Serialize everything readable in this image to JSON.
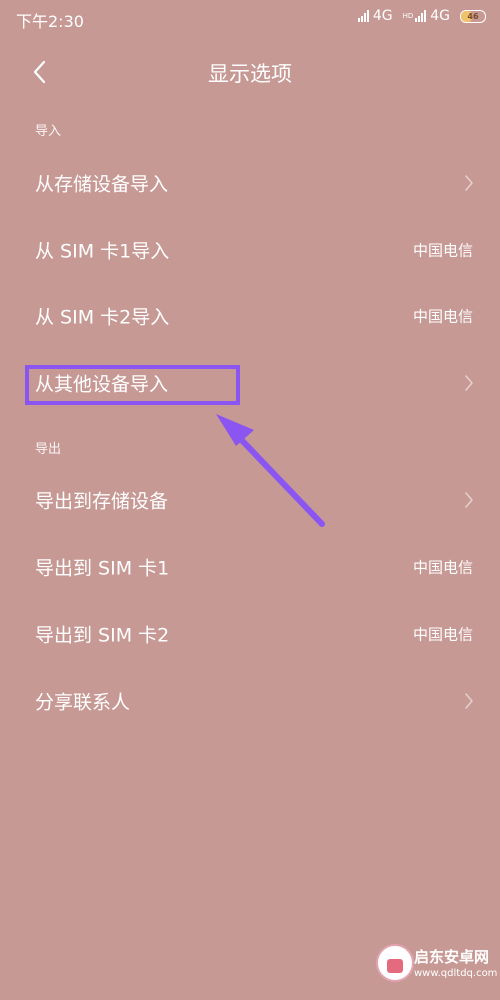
{
  "status_bar": {
    "time": "下午2:30",
    "network_1": "4G",
    "network_2_hd": "HD",
    "network_2": "4G",
    "battery_percent": 46,
    "battery_text": "46"
  },
  "header": {
    "back_icon": "chevron-left-icon",
    "title": "显示选项"
  },
  "sections": {
    "import": {
      "label": "导入",
      "items": [
        {
          "label": "从存储设备导入",
          "value": "",
          "icon": "chevron-right-icon"
        },
        {
          "label": "从 SIM 卡1导入",
          "value": "中国电信"
        },
        {
          "label": "从 SIM 卡2导入",
          "value": "中国电信"
        },
        {
          "label": "从其他设备导入",
          "value": "",
          "icon": "chevron-right-icon"
        }
      ]
    },
    "export": {
      "label": "导出",
      "items": [
        {
          "label": "导出到存储设备",
          "value": "",
          "icon": "chevron-right-icon"
        },
        {
          "label": "导出到 SIM 卡1",
          "value": "中国电信"
        },
        {
          "label": "导出到 SIM 卡2",
          "value": "中国电信"
        },
        {
          "label": "分享联系人",
          "value": "",
          "icon": "chevron-right-icon"
        }
      ]
    }
  },
  "annotation": {
    "color": "#8a55f0"
  },
  "watermark": {
    "title": "启东安卓网",
    "url": "www.qdltdq.com"
  },
  "colors": {
    "background": "#c79995",
    "text": "#ffffff"
  }
}
